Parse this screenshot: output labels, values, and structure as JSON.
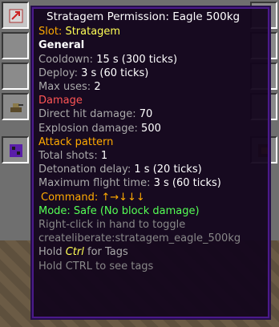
{
  "tooltip": {
    "title": "Stratagem Permission: Eagle 500kg",
    "slot_label": "Slot: ",
    "slot_value": "Stratagem",
    "general_header": "General",
    "cooldown_label": "Cooldown: ",
    "cooldown_value": "15 s (300 ticks)",
    "deploy_label": "Deploy: ",
    "deploy_value": "3 s (60 ticks)",
    "max_uses_label": "Max uses: ",
    "max_uses_value": "2",
    "damage_header": "Damage",
    "direct_hit_label": "Direct hit damage: ",
    "direct_hit_value": "70",
    "explosion_label": "Explosion damage: ",
    "explosion_value": "500",
    "attack_header": "Attack pattern",
    "total_shots_label": "Total shots: ",
    "total_shots_value": "1",
    "detonation_label": "Detonation delay: ",
    "detonation_value": "1 s (20 ticks)",
    "flight_label": "Maximum flight time: ",
    "flight_value": "3 s (60 ticks)",
    "command_label": "Command: ",
    "command_value": "↑→↓↓↓",
    "mode_text": "Mode: Safe (No block damage)",
    "toggle_hint": "Right-click in hand to toggle",
    "item_id": "createliberate:stratagem_eagle_500kg",
    "hold_prefix": "Hold ",
    "hold_key": "Ctrl",
    "hold_suffix": " for Tags",
    "hold_ctrl_hint": "Hold CTRL to see tags"
  },
  "colors": {
    "tooltip_bg": "#12041c",
    "tooltip_border": "#4b1a8a",
    "gold": "#ffaa00",
    "yellow": "#ffff55",
    "red": "#ff5555",
    "green": "#55ff55",
    "gray": "#aaaaaa"
  }
}
